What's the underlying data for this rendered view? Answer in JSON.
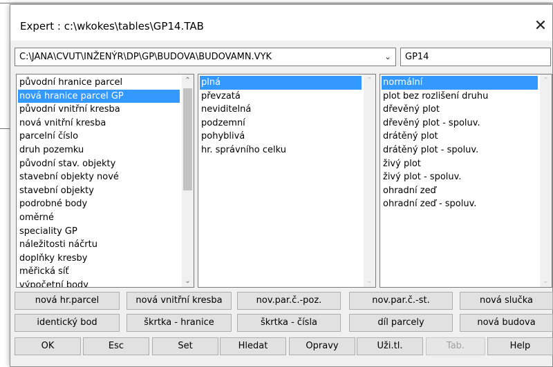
{
  "window": {
    "title": "Expert : c:\\wkokes\\tables\\GP14.TAB",
    "close_glyph": "✕"
  },
  "path_select": {
    "value": "C:\\JANA\\CVUT\\INŽENÝR\\DP\\GP\\BUDOVA\\BUDOVAMN.VYK",
    "arrow": "⌄"
  },
  "name_field": {
    "value": "GP14"
  },
  "list_categories": {
    "items": [
      "původní hranice parcel",
      "nová hranice parcel GP",
      "původní vnitřní kresba",
      "nová vnitřní kresba",
      "parcelní číslo",
      "druh pozemku",
      "původní stav. objekty",
      "stavební objekty nové",
      "stavební objekty",
      "podrobné body",
      "oměrné",
      "speciality GP",
      "náležitosti náčrtu",
      "doplňky kresby",
      "měřická síť",
      "výpočetní body"
    ],
    "selected": 1
  },
  "list_line_types": {
    "items": [
      "plná",
      "převzatá",
      "neviditelná",
      "podzemní",
      "pohyblivá",
      "hr. správního celku"
    ],
    "selected": 0
  },
  "list_subtypes": {
    "items": [
      "normální",
      "plot bez rozlišení druhu",
      "dřevěný plot",
      "dřevěný plot - spoluv.",
      "drátěný plot",
      "drátěný plot - spoluv.",
      "živý plot",
      "živý plot - spoluv.",
      "ohradní zeď",
      "ohradní zeď - spoluv."
    ],
    "selected": 0
  },
  "buttons_row1": [
    "nová hr.parcel",
    "nová vnitřní kresba",
    "nov.par.č.-poz.",
    "nov.par.č.-st.",
    "nová slučka"
  ],
  "buttons_row2": [
    "identický bod",
    "škrtka - hranice",
    "škrtka - čísla",
    "díl parcely",
    "nová budova"
  ],
  "buttons_row3": [
    "OK",
    "Esc",
    "Set",
    "Hledat",
    "Opravy",
    "Uži.tl.",
    "Tab.",
    "Help"
  ],
  "scroll_glyphs": {
    "up": "⌃",
    "down": "⌄"
  }
}
